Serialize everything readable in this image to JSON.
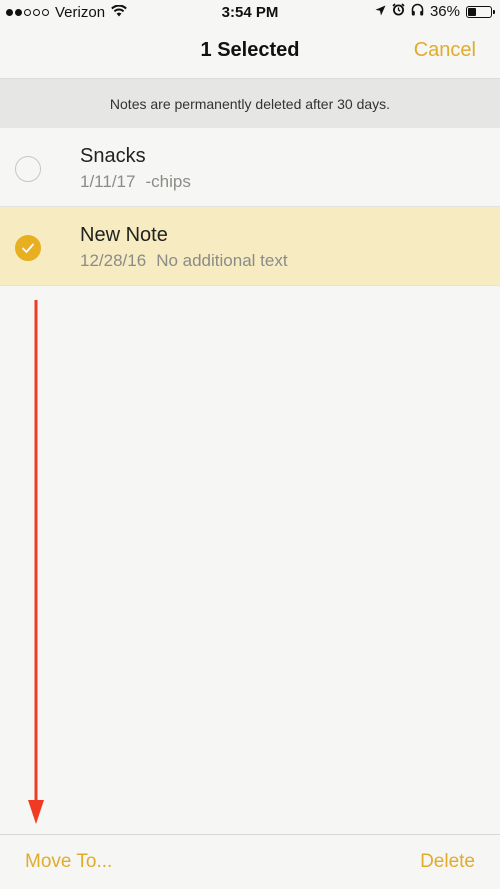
{
  "status_bar": {
    "carrier": "Verizon",
    "time": "3:54 PM",
    "battery": "36%",
    "battery_level": 0.36,
    "signal_bars_filled": 2,
    "signal_bars_total": 5,
    "icons": [
      "wifi-icon",
      "location-icon",
      "alarm-icon",
      "headphones-icon",
      "battery-icon"
    ]
  },
  "nav": {
    "title": "1 Selected",
    "cancel_label": "Cancel"
  },
  "banner": {
    "text": "Notes are permanently deleted after 30 days."
  },
  "notes": [
    {
      "title": "Snacks",
      "date": "1/11/17",
      "preview": "-chips",
      "selected": false
    },
    {
      "title": "New Note",
      "date": "12/28/16",
      "preview": "No additional text",
      "selected": true
    }
  ],
  "toolbar": {
    "move_label": "Move To...",
    "delete_label": "Delete"
  },
  "colors": {
    "accent": "#e0ac2b",
    "selected_row": "#f7ebc2",
    "check_fill": "#e8b020",
    "annotation_arrow": "#f03a22"
  }
}
